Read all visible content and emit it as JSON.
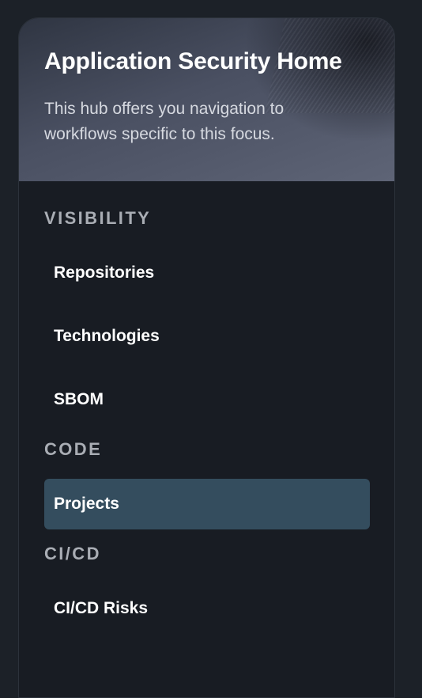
{
  "hero": {
    "title": "Application Security Home",
    "description": "This hub offers you navigation to workflows specific to this focus."
  },
  "sections": [
    {
      "header": "VISIBILITY",
      "items": [
        {
          "label": "Repositories",
          "active": false
        },
        {
          "label": "Technologies",
          "active": false
        },
        {
          "label": "SBOM",
          "active": false
        }
      ]
    },
    {
      "header": "CODE",
      "items": [
        {
          "label": "Projects",
          "active": true
        }
      ]
    },
    {
      "header": "CI/CD",
      "items": [
        {
          "label": "CI/CD Risks",
          "active": false
        }
      ]
    }
  ],
  "colors": {
    "page_background": "#1c2128",
    "panel_background": "#181c23",
    "active_item_background": "#344d5e",
    "section_header_text": "#a9adb4",
    "item_text": "#ffffff"
  }
}
